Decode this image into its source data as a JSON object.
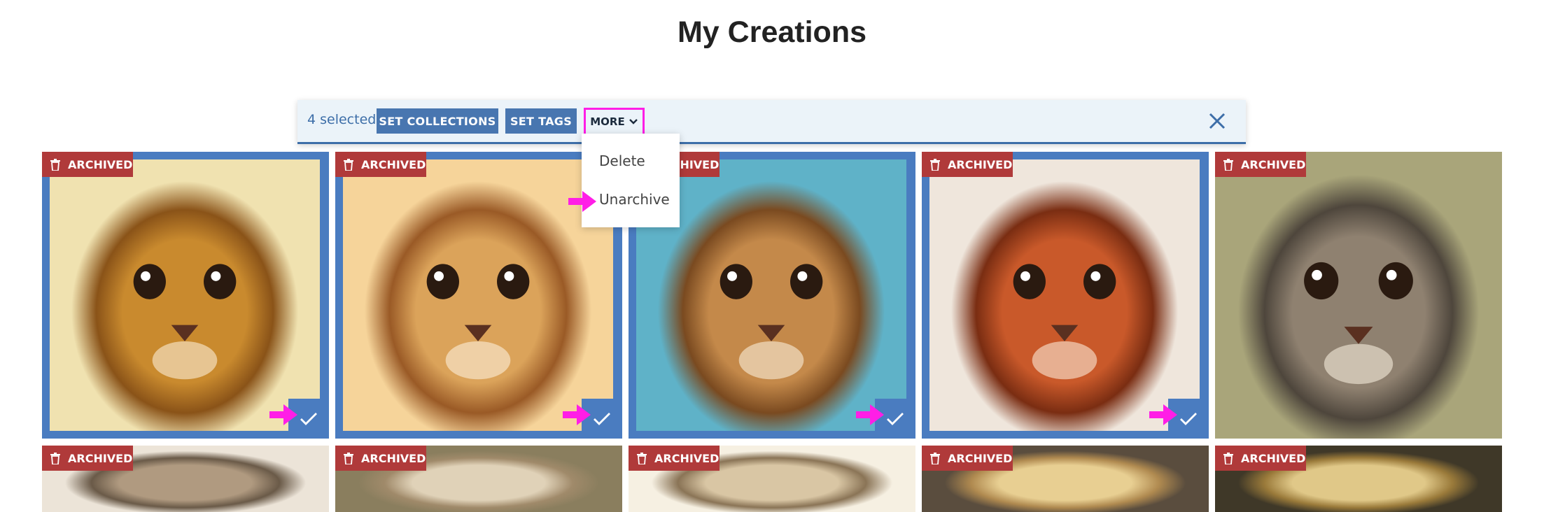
{
  "page": {
    "title": "My Creations"
  },
  "toolbar": {
    "selected_label": "4 selected:",
    "set_collections_label": "SET COLLECTIONS",
    "set_tags_label": "SET TAGS",
    "more_label": "MORE",
    "close_icon": "close-icon"
  },
  "dropdown": {
    "items": [
      "Delete",
      "Unarchive"
    ]
  },
  "badge": {
    "archived_label": "ARCHIVED"
  },
  "colors": {
    "accent": "#4a7cc0",
    "archived_badge": "#b03a3a",
    "toolbar_bg": "#ebf3f9",
    "annotation": "#ff1ee6"
  },
  "cards": [
    {
      "status": "ARCHIVED",
      "selected": true
    },
    {
      "status": "ARCHIVED",
      "selected": true
    },
    {
      "status": "ARCHIVED",
      "selected": true
    },
    {
      "status": "ARCHIVED",
      "selected": true
    },
    {
      "status": "ARCHIVED",
      "selected": false
    },
    {
      "status": "ARCHIVED",
      "selected": false
    },
    {
      "status": "ARCHIVED",
      "selected": false
    },
    {
      "status": "ARCHIVED",
      "selected": false
    },
    {
      "status": "ARCHIVED",
      "selected": false
    },
    {
      "status": "ARCHIVED",
      "selected": false
    }
  ]
}
